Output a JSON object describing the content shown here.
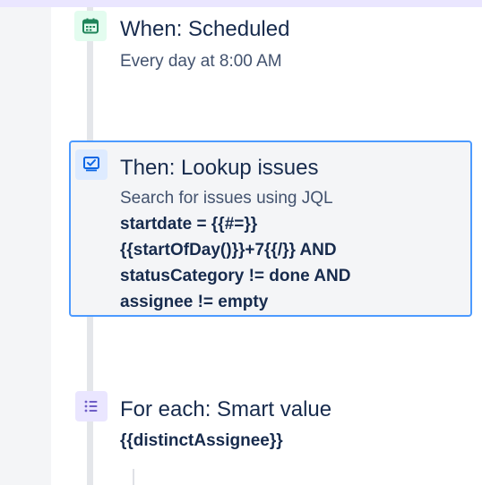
{
  "steps": [
    {
      "type": "trigger",
      "icon": "calendar-icon",
      "title": "When: Scheduled",
      "subtitle": "Every day at 8:00 AM"
    },
    {
      "type": "action",
      "icon": "lookup-issues-icon",
      "title": "Then: Lookup issues",
      "subtitle": "Search for issues using JQL",
      "jql_lines": [
        "startdate = {{#=}}",
        "{{startOfDay()}}+7{{/}} AND",
        "statusCategory != done AND",
        "assignee != empty"
      ]
    },
    {
      "type": "branch",
      "icon": "list-icon",
      "title": "For each: Smart value",
      "value": "{{distinctAssignee}}"
    }
  ],
  "colors": {
    "trigger_icon": "#1f845a",
    "action_icon": "#0c66e4",
    "branch_icon": "#6e5dc6",
    "selected_border": "#4c9aff"
  }
}
